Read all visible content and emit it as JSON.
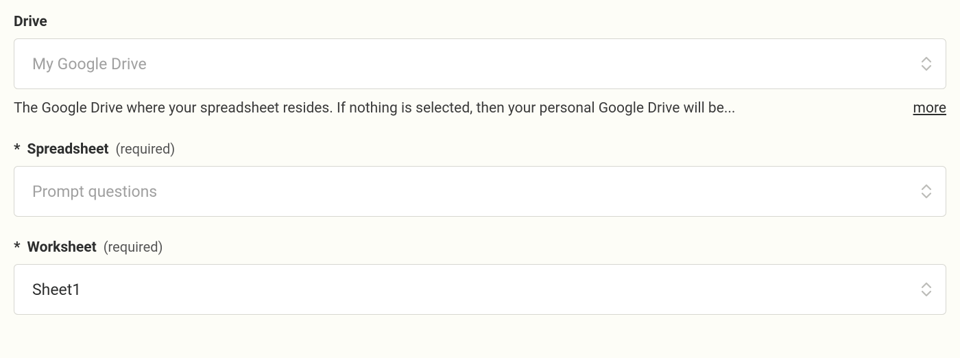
{
  "fields": {
    "drive": {
      "label": "Drive",
      "value": "My Google Drive",
      "is_placeholder": true,
      "help_text": "The Google Drive where your spreadsheet resides. If nothing is selected, then your personal Google Drive will be...",
      "more_label": "more"
    },
    "spreadsheet": {
      "asterisk": "*",
      "label": "Spreadsheet",
      "required_text": "(required)",
      "value": "Prompt questions",
      "is_placeholder": true
    },
    "worksheet": {
      "asterisk": "*",
      "label": "Worksheet",
      "required_text": "(required)",
      "value": "Sheet1",
      "is_placeholder": false
    }
  }
}
